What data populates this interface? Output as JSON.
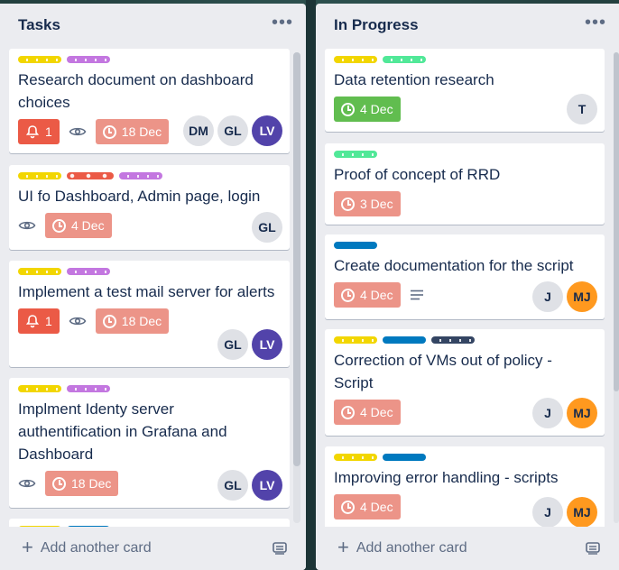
{
  "colors": {
    "yellow": "#f2d600",
    "purple": "#c377e0",
    "green": "#61bd4f",
    "teal": "#51e898",
    "blue": "#0079bf",
    "navy": "#344563",
    "red": "#eb5a46",
    "salmon": "#ec9488"
  },
  "lists": [
    {
      "title": "Tasks",
      "menu": "•••",
      "add_card_label": "Add another card",
      "cards": [
        {
          "title": "Research document on dashboard choices",
          "notifications": "1",
          "due": "18 Dec",
          "members": [
            "DM",
            "GL",
            "LV"
          ]
        },
        {
          "title": "UI fo Dashboard, Admin page, login",
          "due": "4 Dec",
          "members": [
            "GL"
          ]
        },
        {
          "title": "Implement a test mail server for alerts",
          "notifications": "1",
          "due": "18 Dec",
          "members": [
            "GL",
            "LV"
          ]
        },
        {
          "title": "Implment Identy server authentification in Grafana and Dashboard",
          "due": "18 Dec",
          "members": [
            "GL",
            "LV"
          ]
        }
      ]
    },
    {
      "title": "In Progress",
      "menu": "•••",
      "add_card_label": "Add another card",
      "cards": [
        {
          "title": "Data retention research",
          "due": "4 Dec",
          "members": [
            "T"
          ]
        },
        {
          "title": "Proof of concept of RRD",
          "due": "3 Dec",
          "members": []
        },
        {
          "title": "Create documentation for the script",
          "due": "4 Dec",
          "members": [
            "J",
            "MJ"
          ]
        },
        {
          "title": "Correction of VMs out of policy - Script",
          "due": "4 Dec",
          "members": [
            "J",
            "MJ"
          ]
        },
        {
          "title": "Improving error handling - scripts",
          "due": "4 Dec",
          "members": [
            "J",
            "MJ"
          ]
        }
      ]
    }
  ]
}
